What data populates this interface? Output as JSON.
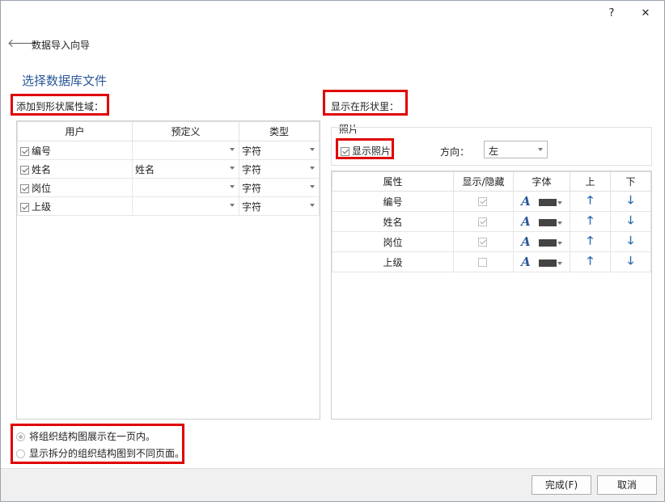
{
  "titlebar": {
    "help": "?",
    "close": "✕"
  },
  "wizard": {
    "title": "数据导入向导",
    "section_title": "选择数据库文件"
  },
  "left": {
    "label": "添加到形状属性域：",
    "columns": [
      "用户",
      "预定义",
      "类型"
    ],
    "rows": [
      {
        "checked": true,
        "name": "编号",
        "predefined": "",
        "type": "字符"
      },
      {
        "checked": true,
        "name": "姓名",
        "predefined": "姓名",
        "type": "字符"
      },
      {
        "checked": true,
        "name": "岗位",
        "predefined": "",
        "type": "字符"
      },
      {
        "checked": true,
        "name": "上级",
        "predefined": "",
        "type": "字符"
      }
    ]
  },
  "right": {
    "label": "显示在形状里：",
    "photo_group_label": "照片",
    "show_photo_label": "显示照片",
    "direction_label": "方向：",
    "direction_value": "左",
    "columns": [
      "属性",
      "显示/隐藏",
      "字体",
      "上",
      "下"
    ],
    "rows": [
      {
        "name": "编号",
        "visible": true
      },
      {
        "name": "姓名",
        "visible": true
      },
      {
        "name": "岗位",
        "visible": true
      },
      {
        "name": "上级",
        "visible": false
      }
    ],
    "font_glyph": "A",
    "up_glyph": "🡑",
    "down_glyph": "🡓"
  },
  "layout_options": {
    "option1": "将组织结构图展示在一页内。",
    "option2": "显示拆分的组织结构图到不同页面。",
    "selected": 1
  },
  "footer": {
    "finish": "完成(F)",
    "cancel": "取消"
  },
  "colors": {
    "highlight": "#e00000",
    "accent": "#2b5797"
  }
}
